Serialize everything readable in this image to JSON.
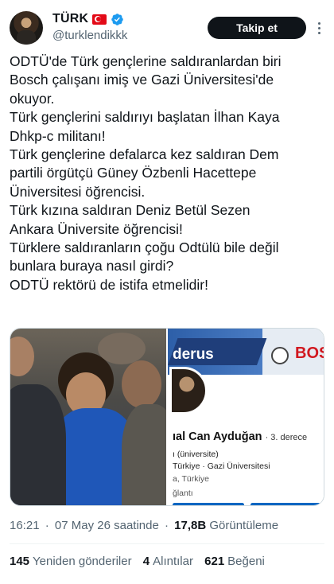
{
  "author": {
    "display_name": "TÜRK",
    "flag": "turkey-flag-icon",
    "verified": "verified-badge-icon",
    "handle": "@turklendikkk"
  },
  "actions": {
    "follow_label": "Takip et",
    "more": "more-options-icon"
  },
  "tweet": {
    "lines": [
      "ODTÜ'de Türk gençlerine saldıranlardan biri",
      "Bosch çalışanı imiş ve Gazi Üniversitesi'de",
      "okuyor.",
      "Türk gençlerini saldırıyı başlatan İlhan Kaya",
      "Dhkp-c militanı!",
      "Türk gençlerine defalarca kez saldıran Dem",
      "partili örgütçü Güney Özbenli Hacettepe",
      "Üniversitesi öğrencisi.",
      "Türk kızına saldıran Deniz Betül Sezen",
      "Ankara Üniversite öğrencisi!",
      "Türklere saldıranların çoğu Odtülü bile değil",
      "bunlara buraya nasıl girdi?",
      "ODTÜ rektörü de istifa etmelidir!"
    ]
  },
  "media": {
    "right": {
      "brand_text": "derus",
      "brand_logo_text": "BOS",
      "profile_name": "ıal Can Ayduğan",
      "profile_degree": "· 3. derece",
      "line1": "ı (üniversite)",
      "line2": "Türkiye · Gazi Üniversitesi",
      "line3": "a, Türkiye",
      "line4": "ğlantı"
    }
  },
  "meta": {
    "time": "16:21",
    "separator": "·",
    "date": "07 May 26 saatinde",
    "views_count": "17,8B",
    "views_label": "Görüntüleme"
  },
  "stats": {
    "retweets_count": "145",
    "retweets_label": "Yeniden gönderiler",
    "quotes_count": "4",
    "quotes_label": "Alıntılar",
    "likes_count": "621",
    "likes_label": "Beğeni"
  },
  "colors": {
    "follow_bg": "#0f1419",
    "muted": "#536471",
    "verified": "#1d9bf0",
    "flag_red": "#e30a17"
  }
}
